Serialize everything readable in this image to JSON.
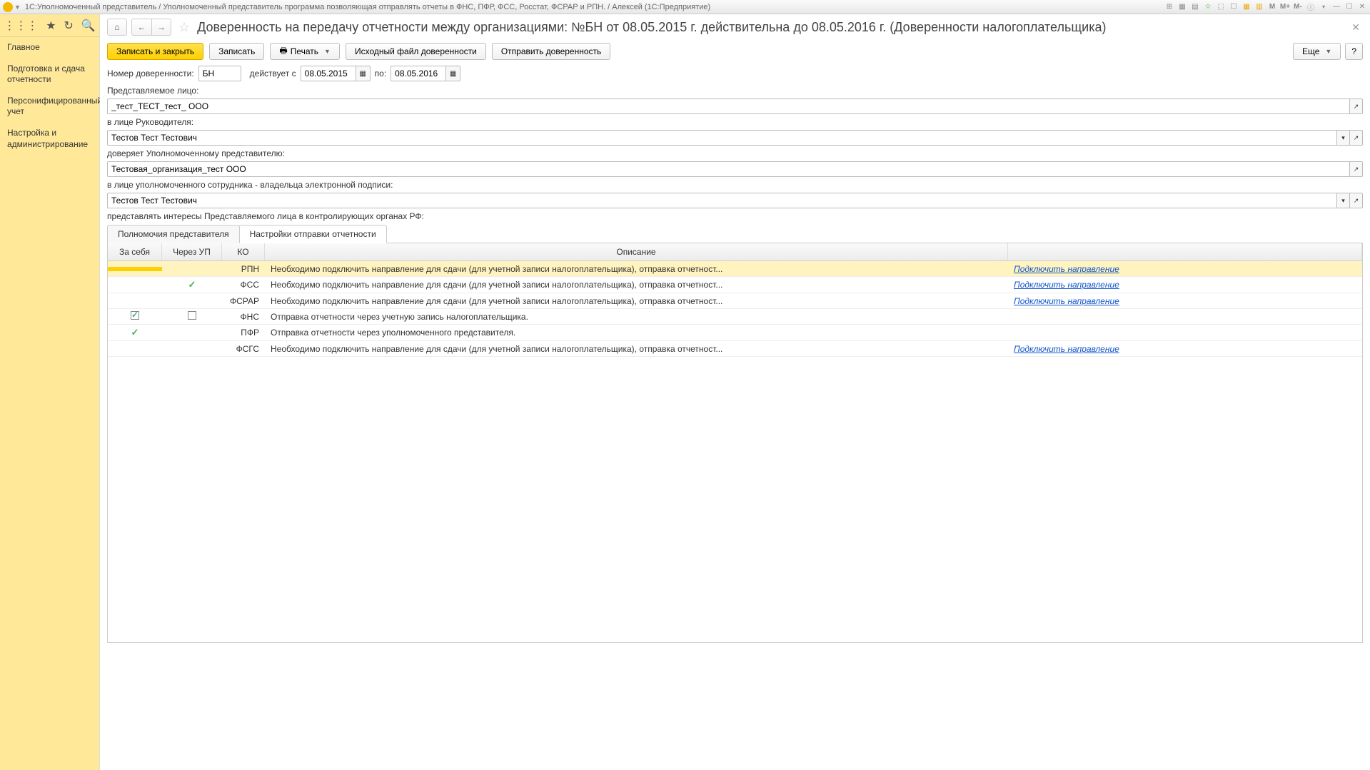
{
  "titlebar": {
    "text": "1С:Уполномоченный представитель / Уполномоченный представитель программа позволяющая отправлять отчеты в ФНС, ПФР, ФСС, Росстат, ФСРАР и РПН. / Алексей  (1С:Предприятие)",
    "m1": "M",
    "m2": "M+",
    "m3": "M-"
  },
  "sidebar": {
    "items": [
      "Главное",
      "Подготовка и сдача отчетности",
      "Персонифицированный учет",
      "Настройка и администрирование"
    ]
  },
  "page": {
    "title": "Доверенность на передачу отчетности между организациями: №БН от 08.05.2015 г. действительна до 08.05.2016 г. (Доверенности налогоплательщика)"
  },
  "toolbar": {
    "save_close": "Записать и закрыть",
    "save": "Записать",
    "print": "Печать",
    "source_file": "Исходный файл доверенности",
    "send": "Отправить доверенность",
    "more": "Еще",
    "help": "?"
  },
  "form": {
    "num_label": "Номер доверенности:",
    "num_value": "БН",
    "valid_from_label": "действует с",
    "valid_from": "08.05.2015",
    "valid_to_label": "по:",
    "valid_to": "08.05.2016",
    "repr_face_label": "Представляемое лицо:",
    "repr_face": "_тест_ТЕСТ_тест_ ООО",
    "head_label": "в лице Руководителя:",
    "head": "Тестов Тест Тестович",
    "trusts_label": "доверяет Уполномоченному представителю:",
    "trusts": "Тестовая_организация_тест ООО",
    "auth_emp_label": "в лице уполномоченного сотрудника  - владельца электронной подписи:",
    "auth_emp": "Тестов Тест Тестович",
    "interests_label": "представлять интересы Представляемого лица в контролирующих органах РФ:"
  },
  "tabs": {
    "t1": "Полномочия представителя",
    "t2": "Настройки отправки отчетности"
  },
  "grid": {
    "headers": {
      "self": "За себя",
      "up": "Через УП",
      "ko": "КО",
      "desc": "Описание"
    },
    "link_text": "Подключить направление",
    "rows": [
      {
        "self": "",
        "up": "",
        "ko": "РПН",
        "desc": "Необходимо подключить направление для сдачи (для учетной записи налогоплательщика), отправка отчетност...",
        "link": true,
        "selected": true
      },
      {
        "self": "",
        "up": "check",
        "ko": "ФСС",
        "desc": "Необходимо подключить направление для сдачи (для учетной записи налогоплательщика), отправка отчетност...",
        "link": true
      },
      {
        "self": "",
        "up": "",
        "ko": "ФСРАР",
        "desc": "Необходимо подключить направление для сдачи (для учетной записи налогоплательщика), отправка отчетност...",
        "link": true
      },
      {
        "self": "cbchecked",
        "up": "cb",
        "ko": "ФНС",
        "desc": "Отправка отчетности через учетную запись налогоплательщика.",
        "link": false
      },
      {
        "self": "check",
        "up": "",
        "ko": "ПФР",
        "desc": "Отправка отчетности через уполномоченного представителя.",
        "link": false
      },
      {
        "self": "",
        "up": "",
        "ko": "ФСГС",
        "desc": "Необходимо подключить направление для сдачи (для учетной записи налогоплательщика), отправка отчетност...",
        "link": true
      }
    ]
  }
}
